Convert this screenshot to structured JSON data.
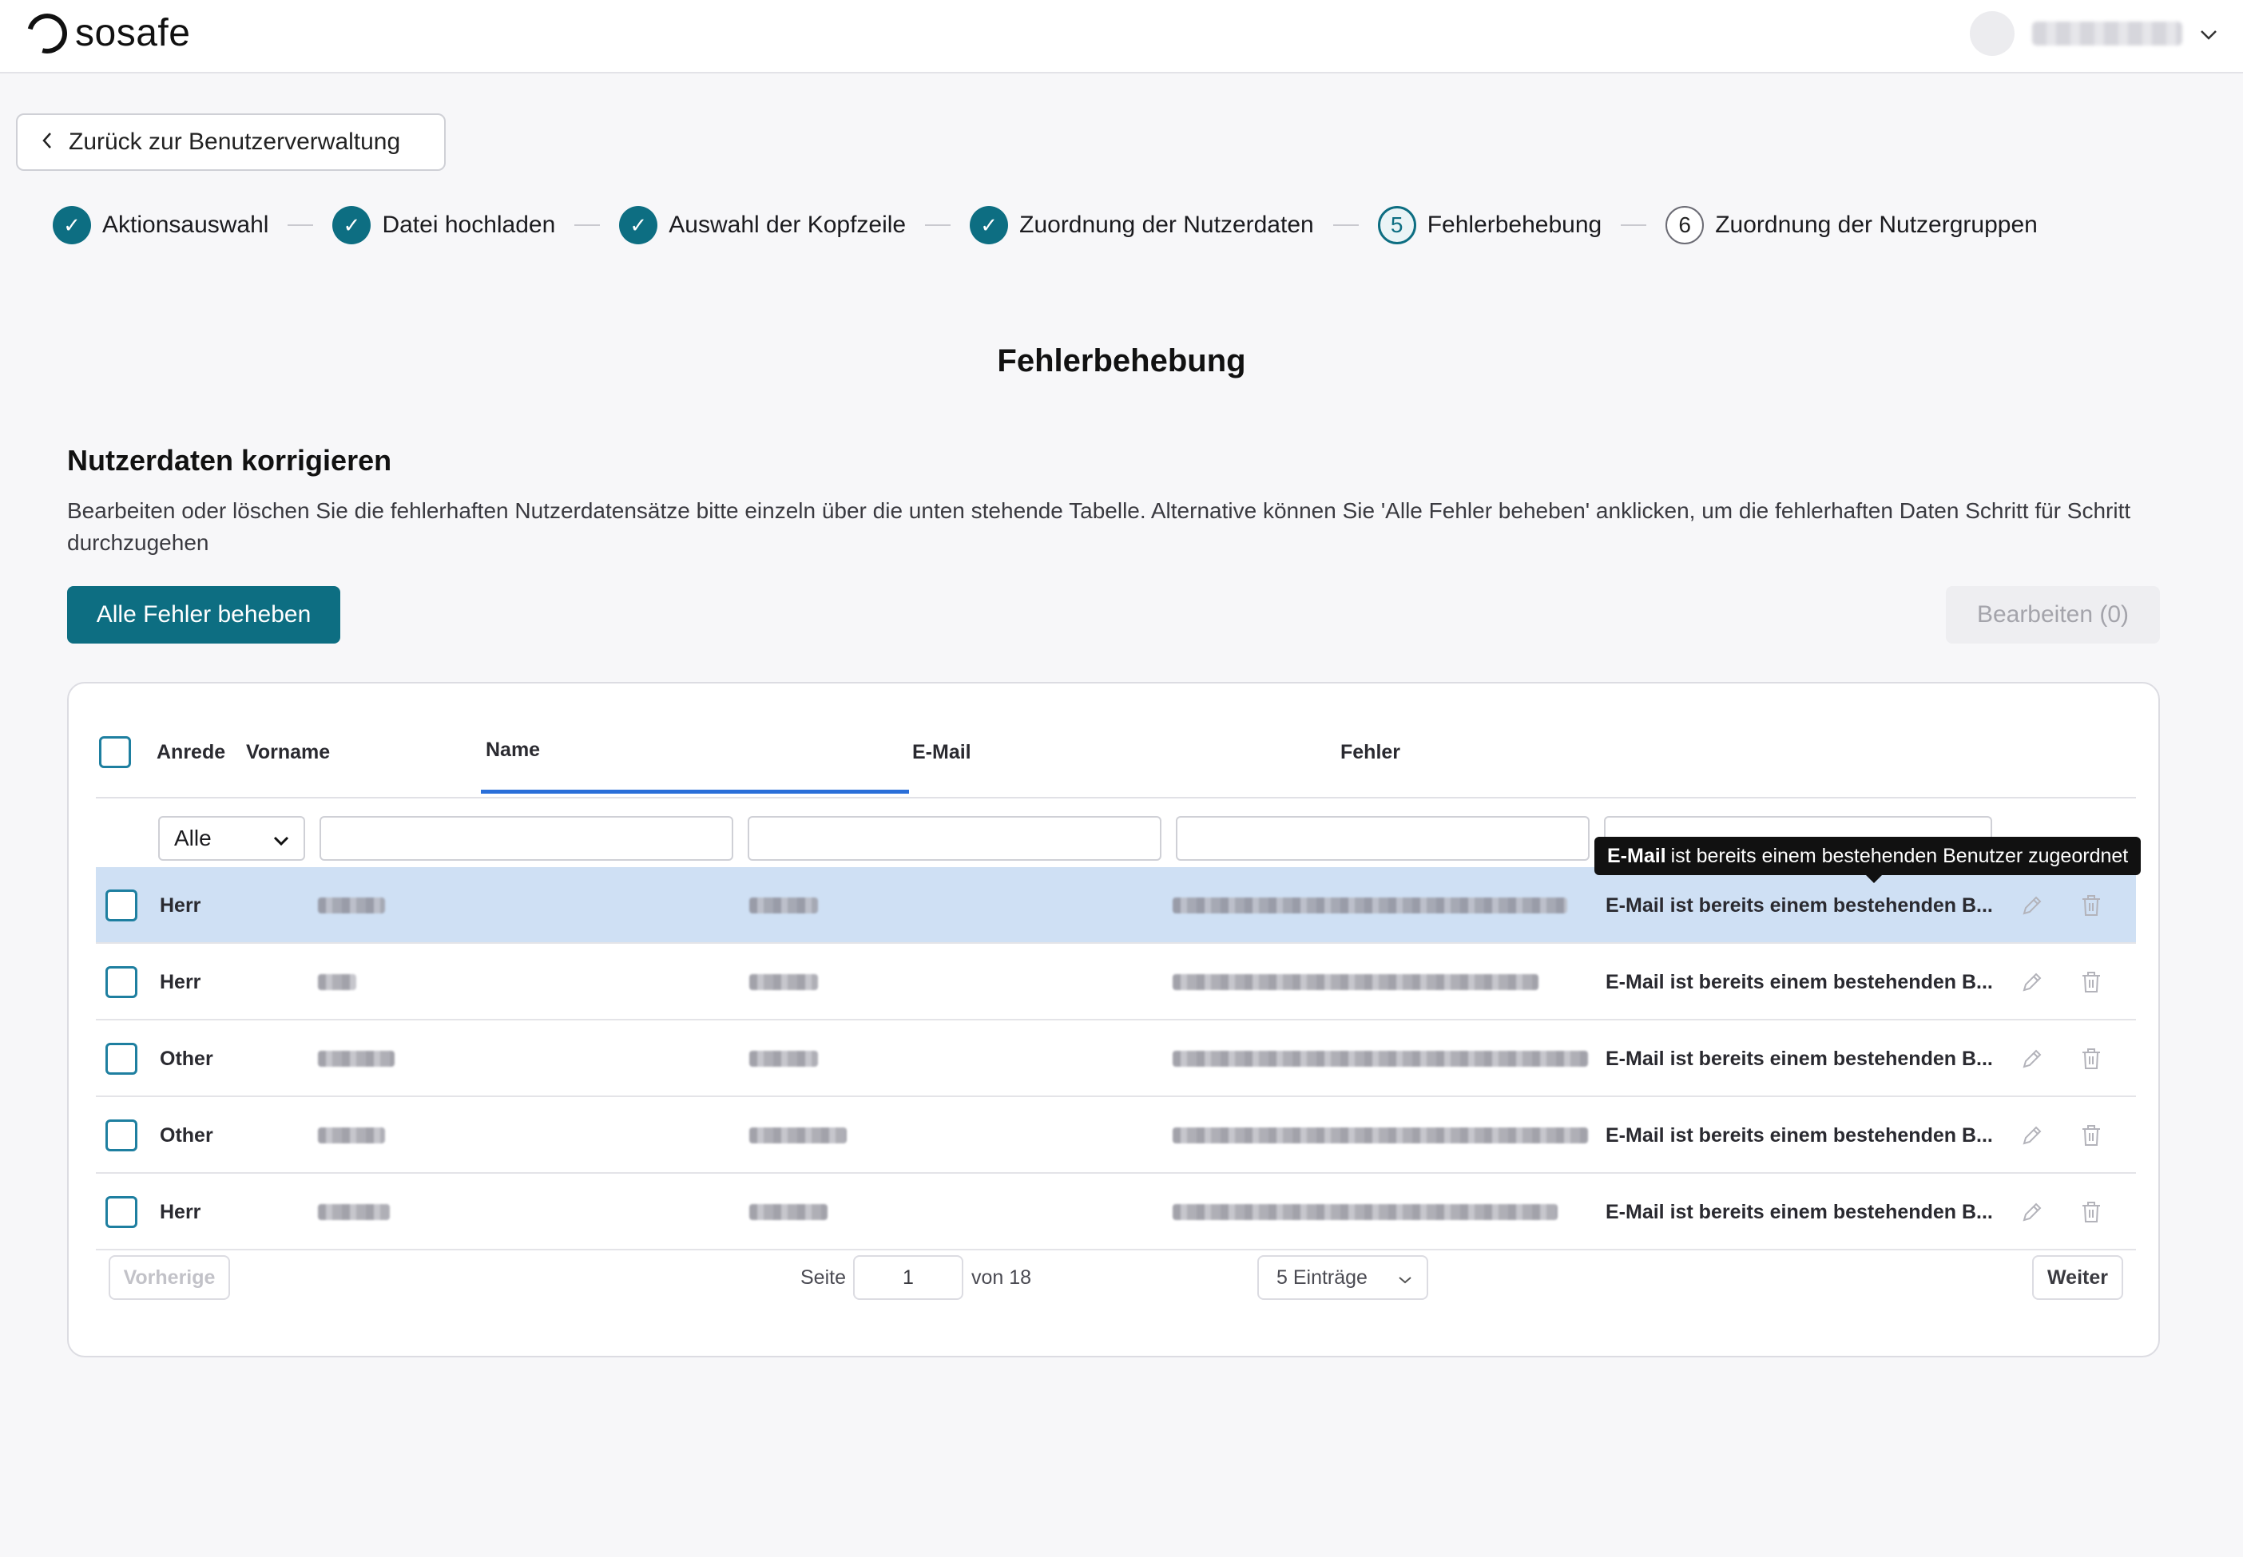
{
  "header": {
    "logo_text": "sosafe",
    "user_menu_icon": "chevron-down-icon"
  },
  "back_button": {
    "label": "Zurück zur Benutzerverwaltung",
    "icon": "chevron-left-icon"
  },
  "stepper": {
    "steps": [
      {
        "label": "Aktionsauswahl",
        "state": "done",
        "marker": "✓"
      },
      {
        "label": "Datei hochladen",
        "state": "done",
        "marker": "✓"
      },
      {
        "label": "Auswahl der Kopfzeile",
        "state": "done",
        "marker": "✓"
      },
      {
        "label": "Zuordnung der Nutzerdaten",
        "state": "done",
        "marker": "✓"
      },
      {
        "label": "Fehlerbehebung",
        "state": "current",
        "marker": "5"
      },
      {
        "label": "Zuordnung der Nutzergruppen",
        "state": "pending",
        "marker": "6"
      }
    ]
  },
  "page": {
    "title": "Fehlerbehebung",
    "section_title": "Nutzerdaten korrigieren",
    "section_description": "Bearbeiten oder löschen Sie die fehlerhaften Nutzerdatensätze bitte einzeln über die unten stehende Tabelle. Alternative können Sie 'Alle Fehler beheben' anklicken, um die fehlerhaften Daten Schritt für Schritt durchzugehen",
    "fix_all_label": "Alle Fehler beheben",
    "edit_label": "Bearbeiten (0)"
  },
  "table": {
    "columns": [
      "Anrede",
      "Vorname",
      "Name",
      "E-Mail",
      "Fehler"
    ],
    "sorted_column": "Name",
    "filter_salutation": "Alle",
    "rows": [
      {
        "salutation": "Herr",
        "error": "E-Mail ist bereits einem bestehenden B...",
        "selected": true
      },
      {
        "salutation": "Herr",
        "error": "E-Mail ist bereits einem bestehenden B...",
        "selected": false
      },
      {
        "salutation": "Other",
        "error": "E-Mail ist bereits einem bestehenden B...",
        "selected": false
      },
      {
        "salutation": "Other",
        "error": "E-Mail ist bereits einem bestehenden B...",
        "selected": false
      },
      {
        "salutation": "Herr",
        "error": "E-Mail ist bereits einem bestehenden B...",
        "selected": false
      }
    ],
    "tooltip": {
      "bold": "E-Mail",
      "text": "ist bereits einem bestehenden Benutzer zugeordnet"
    }
  },
  "pagination": {
    "prev_label": "Vorherige",
    "page_label": "Seite",
    "current_page": "1",
    "of_label": "von 18",
    "page_size": "5 Einträge",
    "next_label": "Weiter"
  },
  "colors": {
    "primary": "#0d6e82",
    "selected_row": "#cfe0f4",
    "sort_indicator": "#2a6fd9"
  }
}
